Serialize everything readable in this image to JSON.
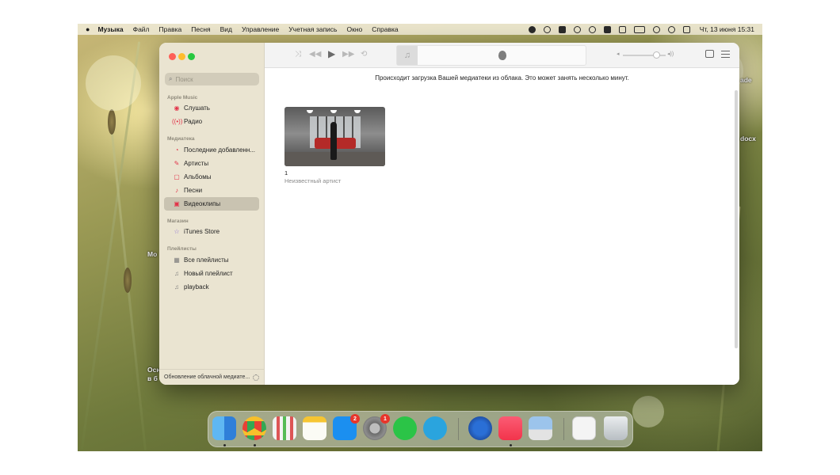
{
  "menubar": {
    "app": "Музыка",
    "items": [
      "Файл",
      "Правка",
      "Песня",
      "Вид",
      "Управление",
      "Учетная запись",
      "Окно",
      "Справка"
    ],
    "clock": "Чт, 13 июня  15:31"
  },
  "desktop_labels": {
    "file_right_1": "ade",
    "file_right_2": "docx",
    "file_left_1": "Мо",
    "file_left_2a": "Осн",
    "file_left_2b": "в б"
  },
  "sidebar": {
    "search_placeholder": "Поиск",
    "apple_music": {
      "title": "Apple Music",
      "items": [
        {
          "label": "Слушать",
          "icon": "play-circle-icon"
        },
        {
          "label": "Радио",
          "icon": "radio-waves-icon"
        }
      ]
    },
    "library": {
      "title": "Медиатека",
      "items": [
        {
          "label": "Последние добавленн...",
          "icon": "clock-icon"
        },
        {
          "label": "Артисты",
          "icon": "microphone-icon"
        },
        {
          "label": "Альбомы",
          "icon": "album-icon"
        },
        {
          "label": "Песни",
          "icon": "music-note-icon"
        },
        {
          "label": "Видеоклипы",
          "icon": "video-icon",
          "selected": true
        }
      ]
    },
    "store": {
      "title": "Магазин",
      "items": [
        {
          "label": "iTunes Store",
          "icon": "star-icon"
        }
      ]
    },
    "playlists": {
      "title": "Плейлисты",
      "items": [
        {
          "label": "Все плейлисты",
          "icon": "grid-icon"
        },
        {
          "label": "Новый плейлист",
          "icon": "playlist-icon"
        },
        {
          "label": "playback",
          "icon": "playlist-icon"
        }
      ]
    },
    "status": "Обновление облачной медиате..."
  },
  "main": {
    "banner": "Происходит загрузка Вашей медиатеки из облака. Это может занять несколько минут.",
    "video": {
      "title": "1",
      "artist": "Неизвестный артист"
    }
  },
  "dock": {
    "app_store_badge": "2",
    "settings_badge": "1"
  },
  "colors": {
    "accent": "#e2344a",
    "traffic_red": "#fe5f57",
    "traffic_yellow": "#febc2e",
    "traffic_green": "#28c840"
  }
}
